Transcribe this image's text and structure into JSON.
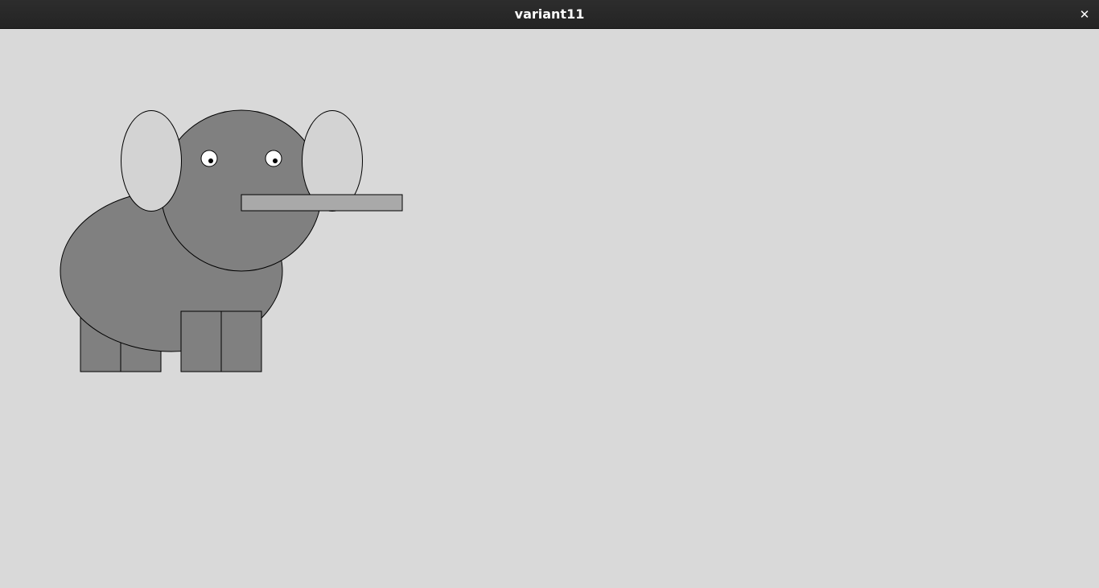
{
  "window": {
    "title": "variant11",
    "close_glyph": "✕",
    "close_icon": "close-icon"
  },
  "drawing": {
    "subject": "elephant",
    "colors": {
      "background": "#d9d9d9",
      "body": "#808080",
      "ears": "#d3d3d3",
      "trunk": "#a9a9a9",
      "eye_white": "#ffffff",
      "pupil": "#000000",
      "outline": "#000000"
    }
  }
}
